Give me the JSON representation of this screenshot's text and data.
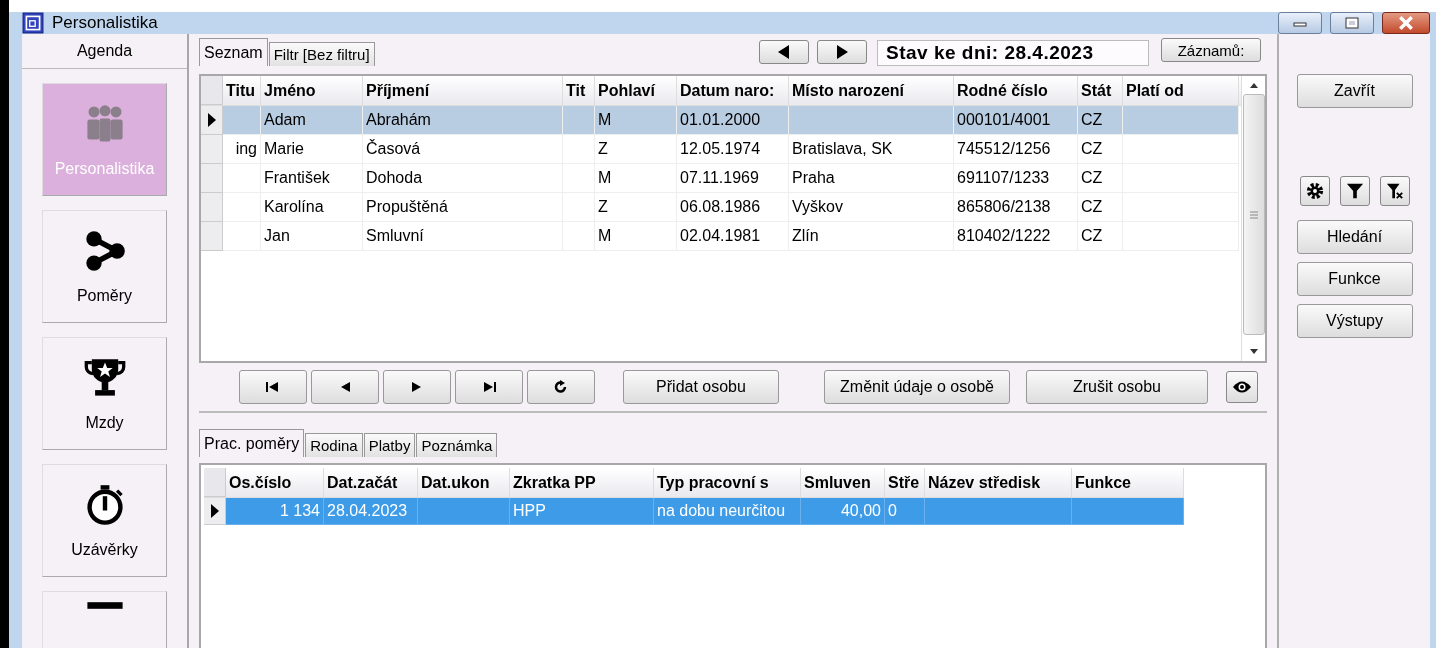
{
  "window": {
    "title": "Personalistika"
  },
  "sidebar": {
    "header": "Agenda",
    "items": [
      {
        "label": "Personalistika",
        "selected": true
      },
      {
        "label": "Poměry",
        "selected": false
      },
      {
        "label": "Mzdy",
        "selected": false
      },
      {
        "label": "Uzávěrky",
        "selected": false
      },
      {
        "selected": false
      }
    ]
  },
  "top_tabs": [
    {
      "label": "Seznam",
      "selected": true
    },
    {
      "label": "Filtr [Bez filtru]",
      "selected": false
    }
  ],
  "date_field": {
    "value": "Stav ke dni: 28.4.2023"
  },
  "records_button": "Záznamů:",
  "people_table": {
    "columns": [
      "Titu",
      "Jméno",
      "Příjmení",
      "Tit",
      "Pohlaví",
      "Datum naro:",
      "Místo narození",
      "Rodné číslo",
      "Stát",
      "Platí od"
    ],
    "rows": [
      {
        "selected": true,
        "cells": [
          "",
          "Adam",
          "Abrahám",
          "",
          "M",
          "01.01.2000",
          "",
          "000101/4001",
          "CZ",
          ""
        ]
      },
      {
        "selected": false,
        "cells": [
          "ing",
          "Marie",
          "Časová",
          "",
          "Z",
          "12.05.1974",
          "Bratislava, SK",
          "745512/1256",
          "CZ",
          ""
        ]
      },
      {
        "selected": false,
        "cells": [
          "",
          "František",
          "Dohoda",
          "",
          "M",
          "07.11.1969",
          "Praha",
          "691107/1233",
          "CZ",
          ""
        ]
      },
      {
        "selected": false,
        "cells": [
          "",
          "Karolína",
          "Propuštěná",
          "",
          "Z",
          "06.08.1986",
          "Vyškov",
          "865806/2138",
          "CZ",
          ""
        ]
      },
      {
        "selected": false,
        "cells": [
          "",
          "Jan",
          "Smluvní",
          "",
          "M",
          "02.04.1981",
          "Zlín",
          "810402/1222",
          "CZ",
          ""
        ]
      }
    ]
  },
  "person_buttons": [
    "Přidat osobu",
    "Změnit údaje o osobě",
    "Zrušit osobu"
  ],
  "bottom_tabs": [
    {
      "label": "Prac. poměry",
      "selected": true
    },
    {
      "label": "Rodina",
      "selected": false
    },
    {
      "label": "Platby",
      "selected": false
    },
    {
      "label": "Poznámka",
      "selected": false
    }
  ],
  "employment_table": {
    "columns": [
      "Os.číslo",
      "Dat.začát",
      "Dat.ukon",
      "Zkratka PP",
      "Typ pracovní s",
      "Smluven",
      "Stře",
      "Název středisk",
      "Funkce"
    ],
    "rows": [
      {
        "selected": true,
        "cells": [
          "1 134",
          "28.04.2023",
          "",
          "HPP",
          "na dobu neurčitou",
          "40,00",
          "0",
          "",
          ""
        ]
      }
    ]
  },
  "side_buttons": {
    "close": "Zavřít",
    "actions": [
      "Hledání",
      "Funkce",
      "Výstupy"
    ]
  }
}
